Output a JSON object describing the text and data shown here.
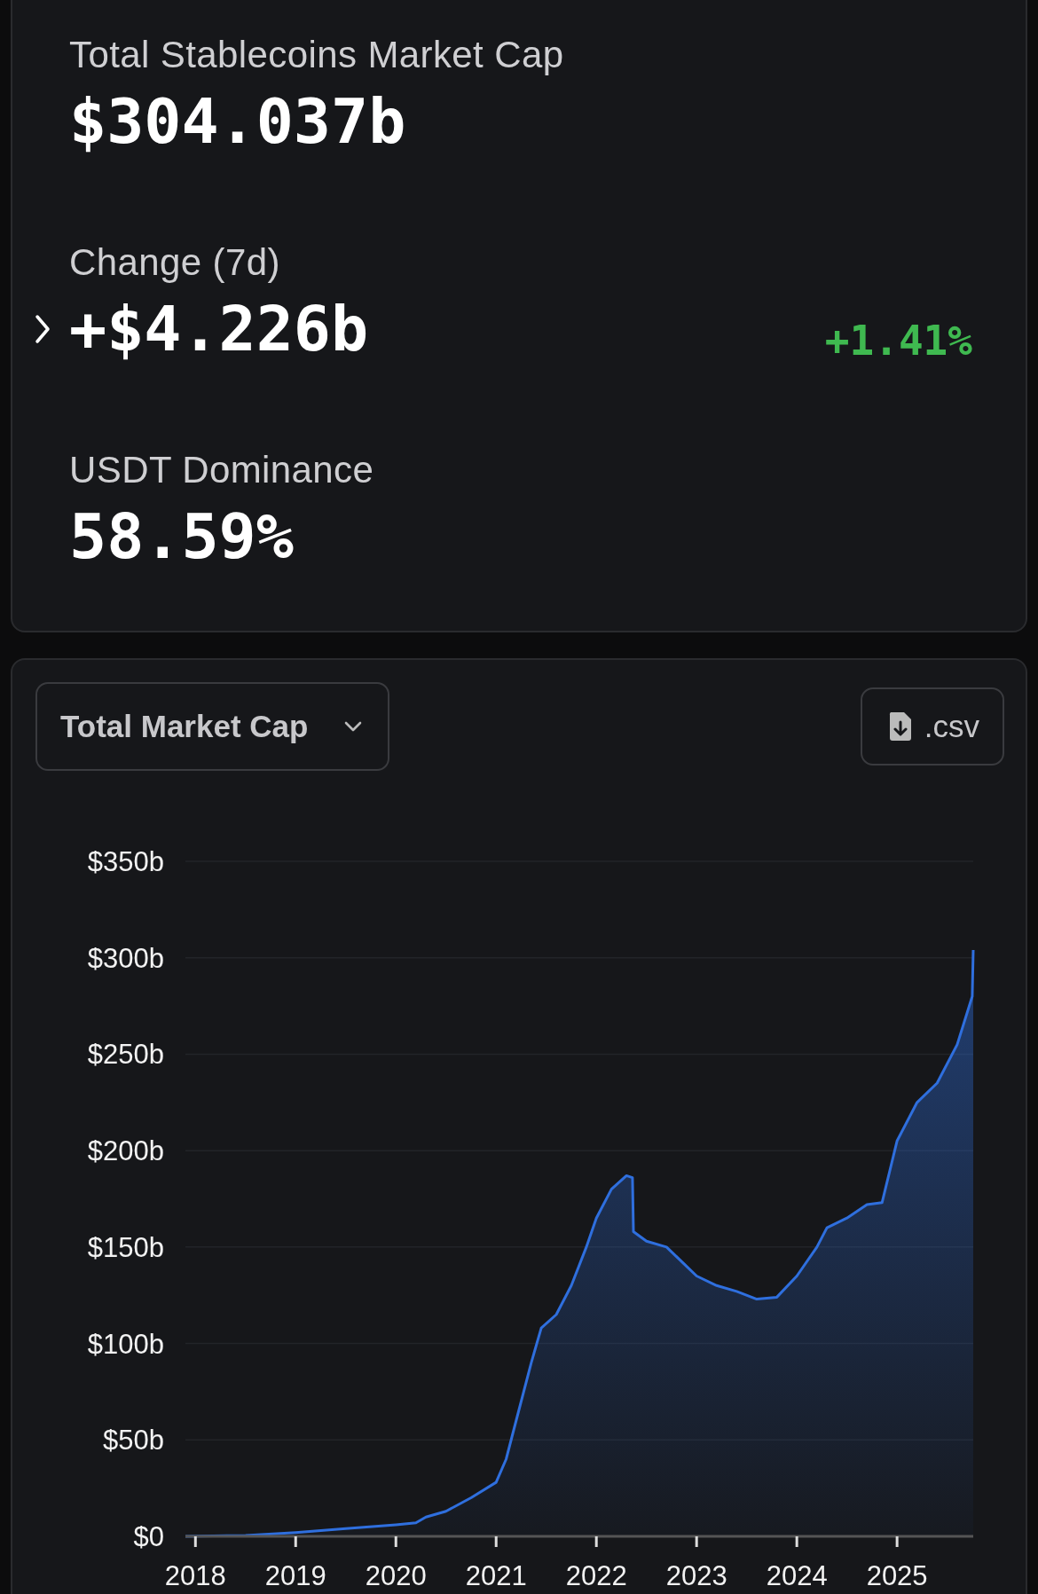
{
  "summary": {
    "stats": [
      {
        "kind": "plain",
        "label": "Total Stablecoins Market Cap",
        "value": "$304.037b"
      },
      {
        "kind": "change",
        "label": "Change (7d)",
        "value": "+$4.226b",
        "percent": "+1.41%",
        "expanded": false
      },
      {
        "kind": "plain",
        "label": "USDT Dominance",
        "value": "58.59%"
      }
    ]
  },
  "chart_panel": {
    "metric_dropdown": {
      "value": "Total Market Cap"
    },
    "download_button": {
      "label": ".csv"
    },
    "chart_data": {
      "type": "area",
      "xlim": [
        2017.9,
        2025.76
      ],
      "ylim": [
        0,
        350
      ],
      "xticks": [
        {
          "value": 2018,
          "label": "2018"
        },
        {
          "value": 2019,
          "label": "2019"
        },
        {
          "value": 2020,
          "label": "2020"
        },
        {
          "value": 2021,
          "label": "2021"
        },
        {
          "value": 2022,
          "label": "2022"
        },
        {
          "value": 2023,
          "label": "2023"
        },
        {
          "value": 2024,
          "label": "2024"
        },
        {
          "value": 2025,
          "label": "2025"
        }
      ],
      "yticks": [
        {
          "value": 0,
          "label": "$0"
        },
        {
          "value": 50,
          "label": "$50b"
        },
        {
          "value": 100,
          "label": "$100b"
        },
        {
          "value": 150,
          "label": "$150b"
        },
        {
          "value": 200,
          "label": "$200b"
        },
        {
          "value": 250,
          "label": "$250b"
        },
        {
          "value": 300,
          "label": "$300b"
        },
        {
          "value": 350,
          "label": "$350b"
        }
      ],
      "x": [
        2017.9,
        2018.5,
        2019,
        2019.5,
        2020,
        2020.2,
        2020.3,
        2020.5,
        2020.75,
        2021,
        2021.1,
        2021.2,
        2021.35,
        2021.45,
        2021.6,
        2021.75,
        2021.9,
        2022,
        2022.15,
        2022.3,
        2022.36,
        2022.37,
        2022.5,
        2022.7,
        2022.9,
        2023,
        2023.2,
        2023.4,
        2023.6,
        2023.8,
        2024,
        2024.2,
        2024.3,
        2024.5,
        2024.7,
        2024.85,
        2025,
        2025.2,
        2025.4,
        2025.6,
        2025.75,
        2025.76
      ],
      "grid": true,
      "series": [
        {
          "color": "#2f6fde",
          "values": [
            0,
            0.5,
            2,
            4,
            6,
            7,
            10,
            13,
            20,
            28,
            40,
            60,
            90,
            108,
            115,
            130,
            150,
            165,
            180,
            187,
            186,
            158,
            153,
            150,
            140,
            135,
            130,
            127,
            123,
            124,
            135,
            150,
            160,
            165,
            172,
            173,
            205,
            225,
            235,
            255,
            280,
            304
          ]
        }
      ]
    }
  }
}
